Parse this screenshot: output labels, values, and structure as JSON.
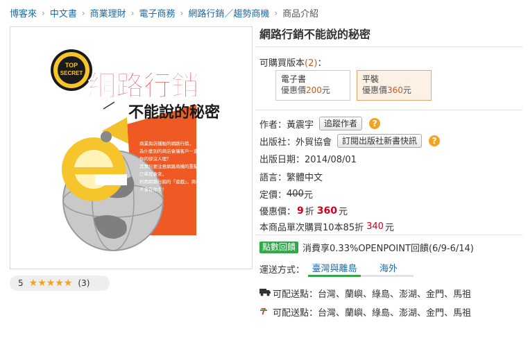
{
  "breadcrumb": [
    "博客來",
    "中文書",
    "商業理財",
    "電子商務",
    "網路行銷／趨勢商機",
    "商品介紹"
  ],
  "book": {
    "title": "網路行銷不能說的秘密",
    "cover": {
      "badge_line1": "TOP",
      "badge_line2": "SECRET",
      "headline": "網路行銷",
      "subhead": "不能說的秘密",
      "body_lines": [
        "商業與店鋪販的網路行銷，",
        "為什麼別的商店會讓客戶一直來，",
        "你的卻沒人理？",
        "其實只要注意網路商機的重點，",
        "訂單就會來，",
        "利用網路行銷的「遊戲」，商機",
        "不會在你手！"
      ]
    },
    "rating": {
      "score": "5",
      "stars": "★★★★★",
      "count": "(3)"
    }
  },
  "versions": {
    "label_prefix": "可購買版本",
    "count": "(2)",
    "label_suffix": "：",
    "items": [
      {
        "name": "電子書",
        "price_label": "優惠價",
        "price": "200",
        "unit": "元"
      },
      {
        "name": "平裝",
        "price_label": "優惠價",
        "price": "360",
        "unit": "元"
      }
    ]
  },
  "info": {
    "author_label": "作者：",
    "author": "黃震宇",
    "follow_author": "追蹤作者",
    "publisher_label": "出版社：",
    "publisher": "外貿協會",
    "subscribe_publisher": "訂閱出版社新書快訊",
    "date": "出版日期：2014/08/01",
    "language": "語言：繁體中文",
    "list_price_label": "定價：",
    "list_price": "400",
    "list_price_unit": "元",
    "sale_label": "優惠價：",
    "discount": "9",
    "discount_unit": "折",
    "sale_price": "360",
    "sale_unit": "元",
    "bulk_text": "本商品單次購買10本85折",
    "bulk_price": "340",
    "bulk_unit": "元",
    "points_badge": "點數回饋",
    "points_text": "消費享0.33%OPENPOINT回饋(6/9-6/14)"
  },
  "shipping": {
    "label": "運送方式：",
    "tabs": [
      "臺灣與離島",
      "海外"
    ],
    "rows": [
      {
        "icon": "truck-icon",
        "text": "可配送點：台灣、蘭嶼、綠島、澎湖、金門、馬祖"
      },
      {
        "icon": "seven-eleven-icon",
        "text": "可配送點：台灣、蘭嶼、綠島、澎湖、金門、馬祖"
      }
    ]
  },
  "colors": {
    "link": "#1b6ba8",
    "price_red": "#d0021b",
    "accent_orange": "#c8571e",
    "points_green": "#31a94a",
    "star": "#f3a322"
  }
}
